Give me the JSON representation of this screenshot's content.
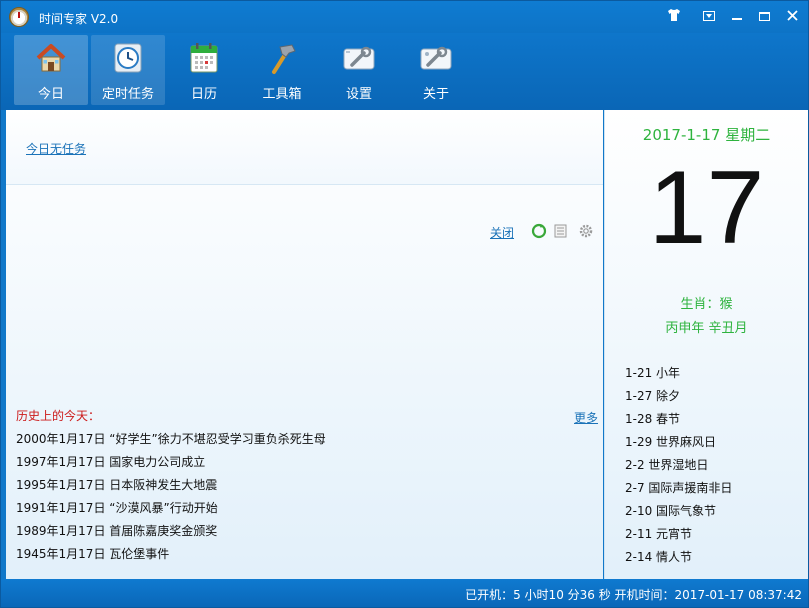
{
  "app": {
    "title": "时间专家 V2.0"
  },
  "window_controls": {
    "skin_icon": "tshirt-icon",
    "menu_icon": "dropdown-menu-icon",
    "minimize_icon": "minimize-icon",
    "maximize_icon": "maximize-icon",
    "close_icon": "close-icon"
  },
  "toolbar": {
    "items": [
      {
        "label": "今日",
        "icon": "house-icon",
        "active": true
      },
      {
        "label": "定时任务",
        "icon": "clock-icon",
        "active": false
      },
      {
        "label": "日历",
        "icon": "calendar-icon",
        "active": false
      },
      {
        "label": "工具箱",
        "icon": "hammer-icon",
        "active": false
      },
      {
        "label": "设置",
        "icon": "wrench-icon",
        "active": false
      },
      {
        "label": "关于",
        "icon": "info-wrench-icon",
        "active": false
      }
    ]
  },
  "tasks": {
    "no_task_text": "今日无任务",
    "close_label": "关闭"
  },
  "history": {
    "title": "历史上的今天：",
    "more_label": "更多",
    "items": [
      "2000年1月17日 “好学生”徐力不堪忍受学习重负杀死生母",
      "1997年1月17日 国家电力公司成立",
      "1995年1月17日 日本阪神发生大地震",
      "1991年1月17日 “沙漠风暴”行动开始",
      "1989年1月17日 首届陈嘉庚奖金颁奖",
      "1945年1月17日 瓦伦堡事件"
    ]
  },
  "calendar": {
    "date_line": "2017-1-17 星期二",
    "day": "17",
    "zodiac": "生肖：猴",
    "lunar": "丙申年 辛丑月",
    "accent_color": "#2eb33e"
  },
  "festivals": [
    "1-21 小年",
    "1-27 除夕",
    "1-28 春节",
    "1-29 世界麻风日",
    "2-2 世界湿地日",
    "2-7 国际声援南非日",
    "2-10 国际气象节",
    "2-11 元宵节",
    "2-14 情人节"
  ],
  "status": {
    "text": "已开机：5 小时10 分36 秒 开机时间：2017-01-17 08:37:42"
  }
}
